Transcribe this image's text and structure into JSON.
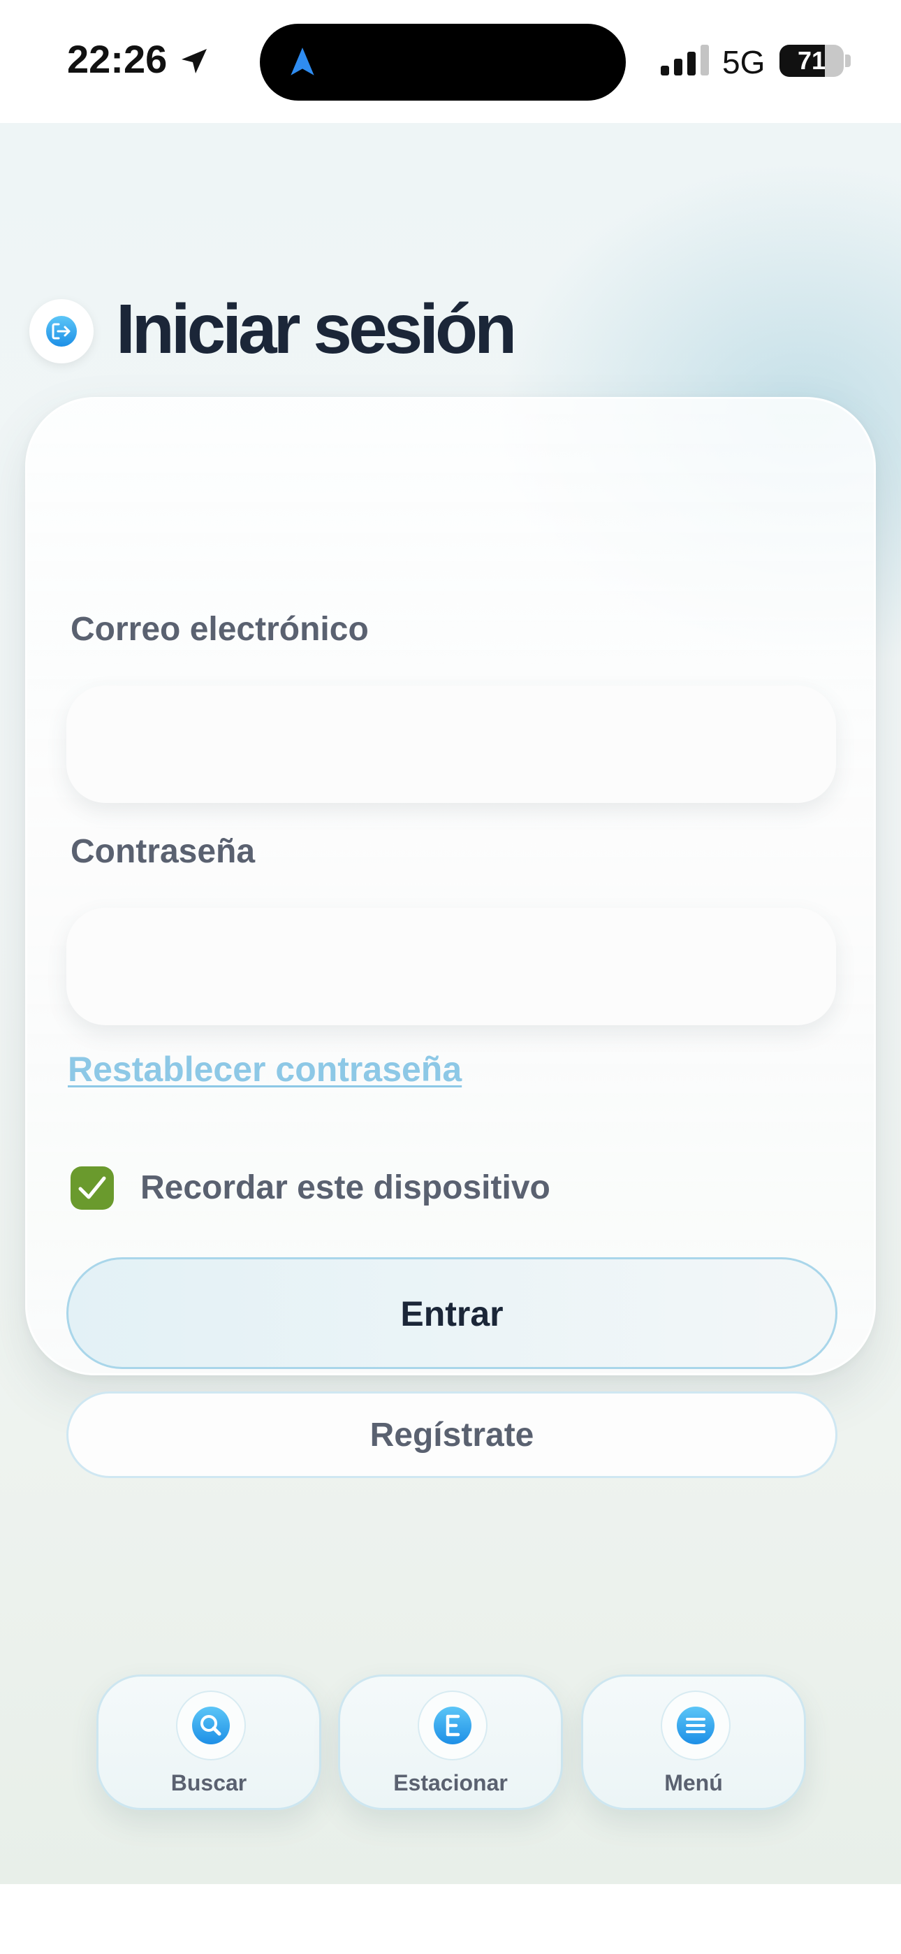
{
  "status_bar": {
    "time": "22:26",
    "network": "5G",
    "battery_percent": "71",
    "battery_level": 0.71
  },
  "page": {
    "title": "Iniciar sesión",
    "title_icon": "login-arrow-icon"
  },
  "form": {
    "email_label": "Correo electrónico",
    "email_value": "",
    "password_label": "Contraseña",
    "password_value": "",
    "reset_link": "Restablecer contraseña",
    "remember_label": "Recordar este dispositivo",
    "remember_checked": true,
    "submit_label": "Entrar",
    "register_label": "Regístrate"
  },
  "bottom_nav": {
    "items": [
      {
        "label": "Buscar",
        "icon": "search-icon"
      },
      {
        "label": "Estacionar",
        "icon": "parking-e-icon"
      },
      {
        "label": "Menú",
        "icon": "menu-icon"
      }
    ]
  },
  "colors": {
    "accent_blue": "#2fa6ee",
    "link": "#8dc8e6",
    "checkbox": "#6a9a2d",
    "title_text": "#1b2638",
    "label_text": "#5a6170"
  }
}
